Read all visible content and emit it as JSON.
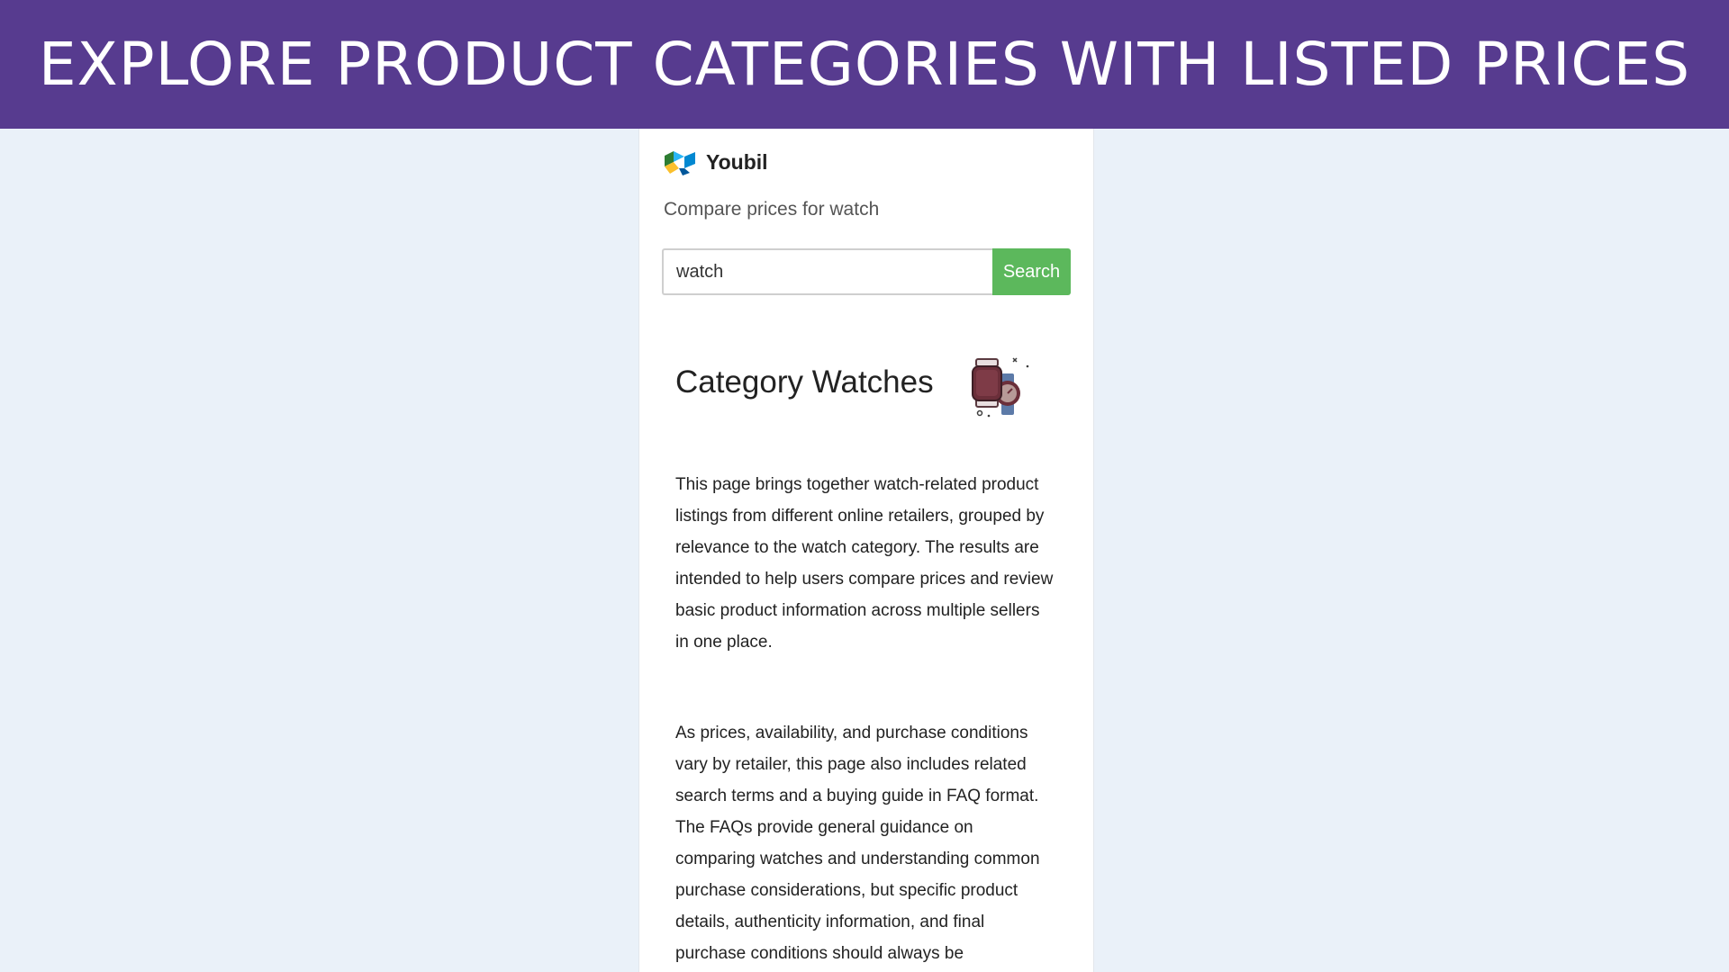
{
  "banner": {
    "title": "EXPLORE PRODUCT CATEGORIES WITH LISTED PRICES"
  },
  "colors": {
    "banner_bg": "#573b8f",
    "page_bg": "#eaf1f9",
    "search_button": "#5cb85c"
  },
  "site": {
    "name": "Youbil",
    "compare_text": "Compare prices for watch"
  },
  "search": {
    "value": "watch",
    "button_label": "Search"
  },
  "category": {
    "title": "Category Watches",
    "icon": "watches-icon"
  },
  "content": {
    "paragraph1": "This page brings together watch-related product listings from different online retailers, grouped by relevance to the watch category. The results are intended to help users compare prices and review basic product information across multiple sellers in one place.",
    "paragraph2": "As prices, availability, and purchase conditions vary by retailer, this page also includes related search terms and a buying guide in FAQ format. The FAQs provide general guidance on comparing watches and understanding common purchase considerations, but specific product details, authenticity information, and final purchase conditions should always be"
  }
}
